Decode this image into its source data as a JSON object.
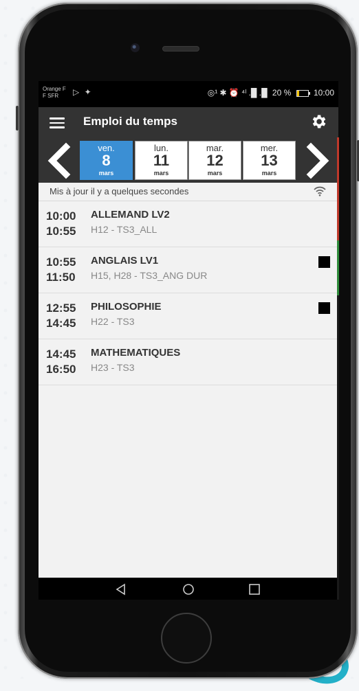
{
  "status_bar": {
    "carrier_line1": "Orange F",
    "carrier_line2": "F SFR",
    "left_icons": "▷ ✦",
    "right_icons": "◎¹ ✱ ⏰ ⁴ˡ .█ .█",
    "battery_percent": "20 %",
    "time": "10:00"
  },
  "app_bar": {
    "title": "Emploi du temps"
  },
  "date_strip": {
    "days": [
      {
        "name": "ven.",
        "number": "8",
        "month": "mars",
        "active": true
      },
      {
        "name": "lun.",
        "number": "11",
        "month": "mars",
        "active": false
      },
      {
        "name": "mar.",
        "number": "12",
        "month": "mars",
        "active": false
      },
      {
        "name": "mer.",
        "number": "13",
        "month": "mars",
        "active": false
      }
    ]
  },
  "update_status": "Mis à jour il y a quelques secondes",
  "lessons": [
    {
      "start": "10:00",
      "end": "10:55",
      "subject": "ALLEMAND LV2",
      "detail": "H12 - TS3_ALL",
      "flag": false
    },
    {
      "start": "10:55",
      "end": "11:50",
      "subject": "ANGLAIS LV1",
      "detail": "H15, H28 - TS3_ANG DUR",
      "flag": true
    },
    {
      "start": "12:55",
      "end": "14:45",
      "subject": "PHILOSOPHIE",
      "detail": "H22 - TS3",
      "flag": true
    },
    {
      "start": "14:45",
      "end": "16:50",
      "subject": "MATHEMATIQUES",
      "detail": "H23 - TS3",
      "flag": false
    }
  ],
  "colors": {
    "app_bar": "#333333",
    "active_day": "#3b8fd4",
    "screen_bg": "#f2f2f2",
    "lesson_flag": "#000000"
  }
}
